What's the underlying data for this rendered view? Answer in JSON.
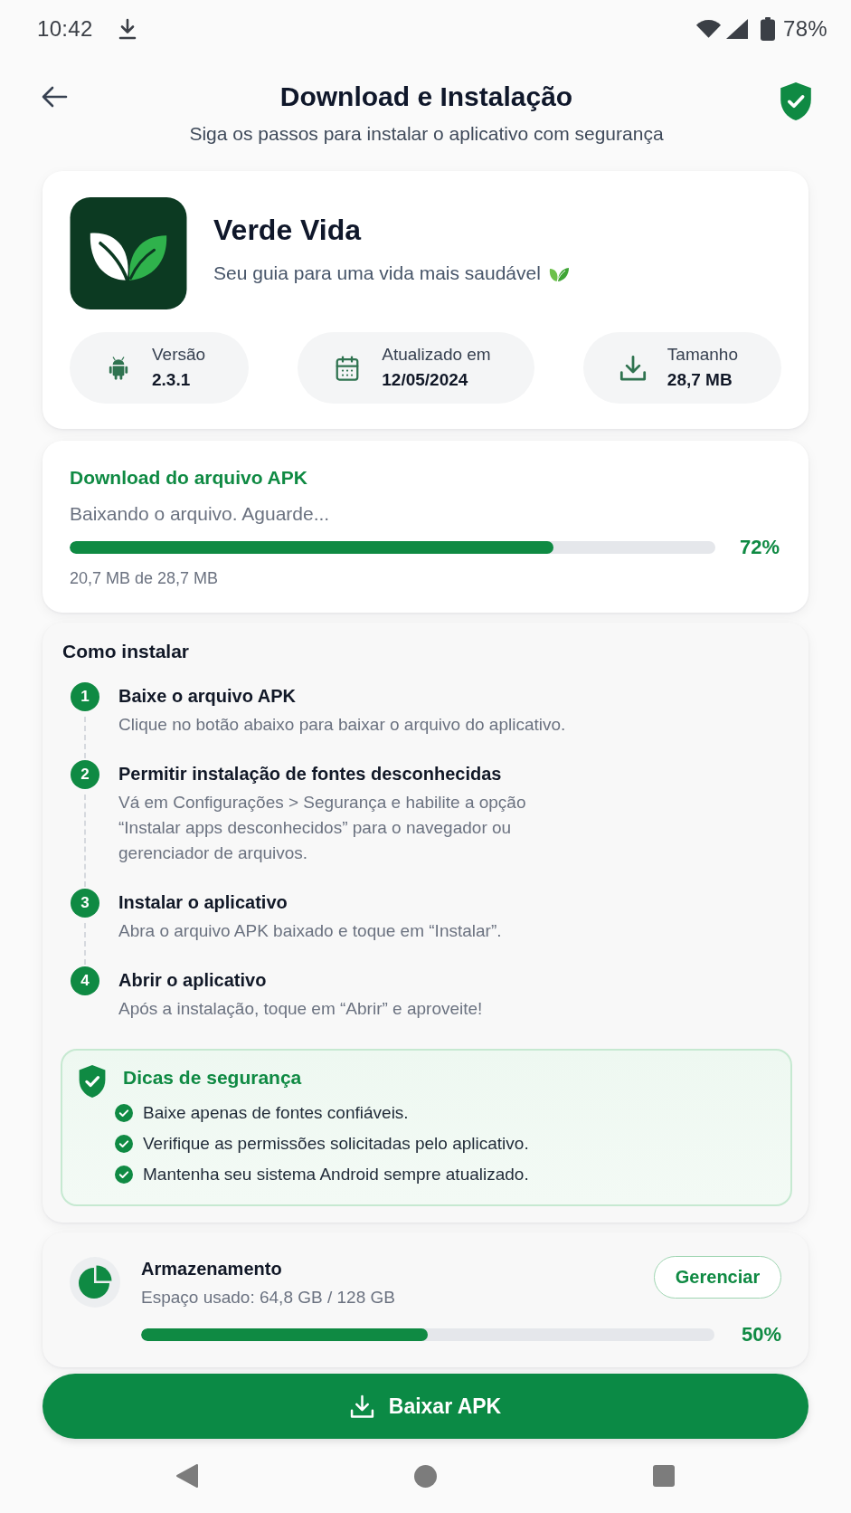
{
  "status_bar": {
    "time": "10:42",
    "battery": "78%"
  },
  "header": {
    "title": "Download e Instalação",
    "subtitle": "Siga os passos para instalar o aplicativo com segurança"
  },
  "app": {
    "name": "Verde Vida",
    "tagline": "Seu guia para uma vida mais saudável",
    "details": [
      {
        "kind": "version",
        "label": "Versão",
        "value": "2.3.1"
      },
      {
        "kind": "updated",
        "label": "Atualizado em",
        "value": "12/05/2024"
      },
      {
        "kind": "size",
        "label": "Tamanho",
        "value": "28,7 MB"
      }
    ]
  },
  "download": {
    "title": "Download do arquivo APK",
    "status": "Baixando o arquivo. Aguarde...",
    "level": 0.75,
    "percent": "72%",
    "progress_text": "20,7 MB de 28,7 MB"
  },
  "install": {
    "title": "Como instalar",
    "steps": [
      {
        "number": "1",
        "title": "Baixe o arquivo APK",
        "description": "Clique no botão abaixo para baixar o arquivo do aplicativo."
      },
      {
        "number": "2",
        "title": "Permitir instalação de fontes desconhecidas",
        "description": "Vá em Configurações > Segurança e habilite a opção “Instalar apps desconhecidos” para o navegador ou gerenciador de arquivos."
      },
      {
        "number": "3",
        "title": "Instalar o aplicativo",
        "description": "Abra o arquivo APK baixado e toque em “Instalar”."
      },
      {
        "number": "4",
        "title": "Abrir o aplicativo",
        "description": "Após a instalação, toque em “Abrir” e aproveite!"
      }
    ],
    "safety": {
      "title": "Dicas de segurança",
      "tips": [
        "Baixe apenas de fontes confiáveis.",
        "Verifique as permissões solicitadas pelo aplicativo.",
        "Mantenha seu sistema Android sempre atualizado."
      ]
    }
  },
  "storage": {
    "title": "Armazenamento",
    "usage": "Espaço usado: 64,8 GB / 128 GB",
    "button": "Gerenciar",
    "level": 0.5,
    "percent": "50%"
  },
  "primary_button": {
    "label": "Baixar APK"
  }
}
